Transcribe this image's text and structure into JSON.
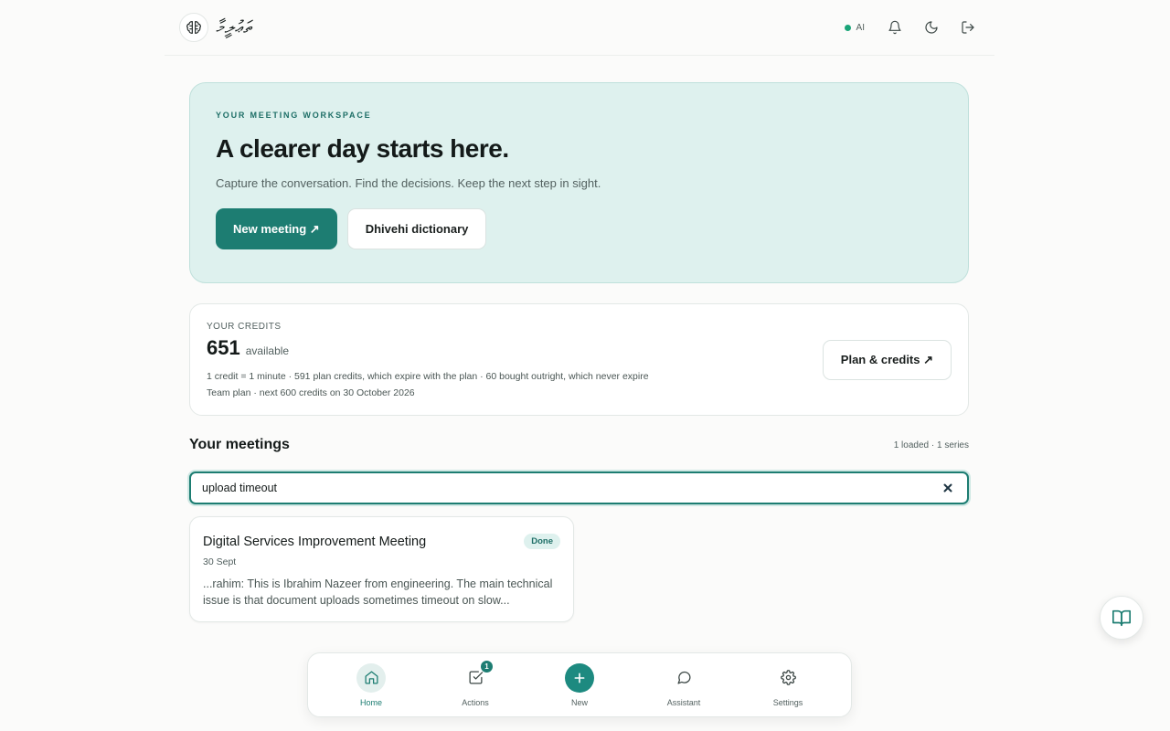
{
  "header": {
    "brand_name": "ތަޢުލީމާ",
    "ai_label": "AI"
  },
  "hero": {
    "eyebrow": "YOUR MEETING WORKSPACE",
    "title": "A clearer day starts here.",
    "subtitle": "Capture the conversation. Find the decisions. Keep the next step in sight.",
    "primary_button": "New meeting ↗",
    "secondary_button": "Dhivehi dictionary"
  },
  "credits": {
    "label": "YOUR CREDITS",
    "amount": "651",
    "amount_suffix": "available",
    "detail_line1": "1 credit = 1 minute · 591 plan credits, which expire with the plan · 60 bought outright, which never expire",
    "detail_line2": "Team plan · next 600 credits on 30 October 2026",
    "button": "Plan & credits ↗"
  },
  "meetings": {
    "title": "Your meetings",
    "count": "1 loaded · 1 series",
    "search_value": "upload timeout",
    "items": [
      {
        "title": "Digital Services Improvement Meeting",
        "status": "Done",
        "date": "30 Sept",
        "snippet": "...rahim: This is Ibrahim Nazeer from engineering. The main technical issue is that document uploads sometimes timeout on slow..."
      }
    ]
  },
  "nav": {
    "home": "Home",
    "actions": "Actions",
    "actions_badge": "1",
    "new": "New",
    "assistant": "Assistant",
    "settings": "Settings"
  },
  "colors": {
    "accent": "#1d7d72",
    "hero_bg": "#def1ee",
    "status_dot": "#1aa478"
  }
}
